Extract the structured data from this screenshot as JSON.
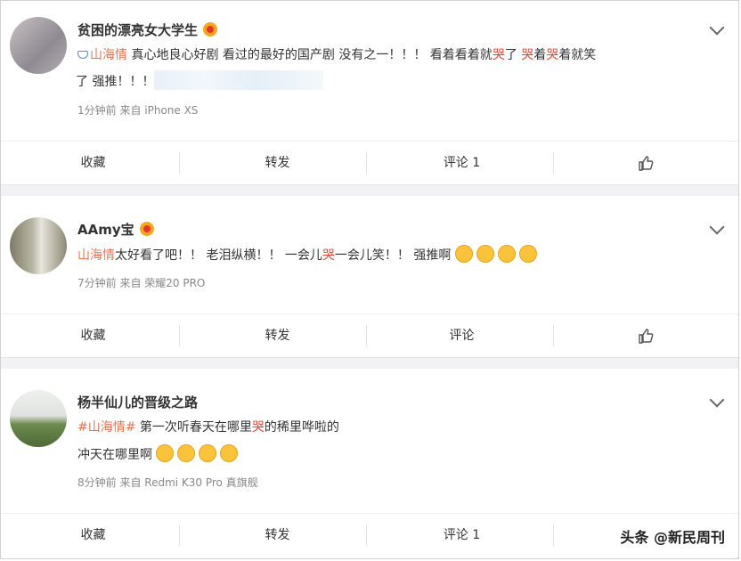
{
  "posts": [
    {
      "username": "贫困的漂亮女大学生",
      "text_line1_tag": "山海情",
      "text_line1_a": " 真心地良心好剧 看过的最好的国产剧 没有之一！！！ 看着看着就",
      "cry": "哭",
      "text_line1_b": "了 ",
      "text_line1_c": "着",
      "text_line1_d": "着就笑",
      "text_line2": "了 强推！！！",
      "meta": "1分钟前  来自 iPhone XS",
      "actions": {
        "fav": "收藏",
        "repost": "转发",
        "comment": "评论 1"
      }
    },
    {
      "username": "AAmy宝",
      "text_tag": "山海情",
      "text_a": "太好看了吧！！ 老泪纵横！！ 一会儿",
      "cry": "哭",
      "text_b": "一会儿笑！！ 强推啊",
      "meta": "7分钟前  来自 荣耀20 PRO",
      "actions": {
        "fav": "收藏",
        "repost": "转发",
        "comment": "评论"
      }
    },
    {
      "username": "杨半仙儿的晋级之路",
      "text_tag": "#山海情#",
      "text_a": " 第一次听春天在哪里",
      "cry": "哭",
      "text_b": "的稀里哗啦的",
      "text_line2": "冲天在哪里啊",
      "meta": "8分钟前  来自 Redmi K30 Pro 真旗舰",
      "actions": {
        "fav": "收藏",
        "repost": "转发",
        "comment": "评论 1"
      }
    }
  ],
  "watermark": "头条 @新民周刊",
  "colors": {
    "link": "#eb7350",
    "cry": "#eb3f2f",
    "separator": "#f2f2f5"
  }
}
